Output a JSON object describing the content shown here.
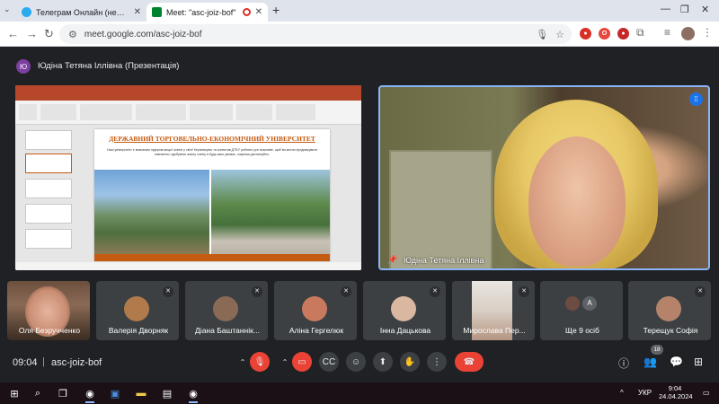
{
  "browser": {
    "tabs": [
      {
        "title": "Телеграм Онлайн (неофіційний)",
        "favicon_color": "#2aabee",
        "active": false
      },
      {
        "title": "Meet: \"asc-joiz-bof\"",
        "favicon_color": "#00832d",
        "active": true,
        "recording": true
      }
    ],
    "new_tab_label": "+",
    "url": "meet.google.com/asc-joiz-bof"
  },
  "meet": {
    "presenter_initial": "Ю",
    "presenter_label": "Юдіна Тетяна Іллівна (Презентація)",
    "slide": {
      "title": "ДЕРЖАВНИЙ ТОРГОВЕЛЬНО-ЕКОНОМІЧНИЙ УНІВЕРСИТЕТ",
      "text": "Наш університет є визнаним лідером вищої освіти у світі! Керівництво та колектив ДТЕУ роблять усе можливе, щоб ви могли продовжувати навчання і здобувати якісну освіту в будь-яких умовах, зокрема дистанційно."
    },
    "speaker_name": "Юдіна Тетяна Іллівна",
    "participants": [
      {
        "name": "Оля Безручченко",
        "avatar_color": "",
        "muted": false,
        "video": true
      },
      {
        "name": "Валерія Дворняк",
        "avatar_color": "#b07a4a",
        "muted": true,
        "video": false
      },
      {
        "name": "Діана Баштаннік...",
        "avatar_color": "#8a6a55",
        "muted": true,
        "video": false
      },
      {
        "name": "Аліна Гергелюк",
        "avatar_color": "#c97a5e",
        "muted": true,
        "video": false
      },
      {
        "name": "Інна Дацькова",
        "avatar_color": "#d9b7a0",
        "muted": true,
        "video": false
      },
      {
        "name": "Мирослава Пер...",
        "avatar_color": "",
        "muted": true,
        "video": true
      },
      {
        "name": "Ще 9 осіб",
        "avatar_color": "#5f6368",
        "muted": false,
        "video": false,
        "more_initial": "А"
      },
      {
        "name": "Терещук Софія",
        "avatar_color": "#b5836a",
        "muted": true,
        "video": false
      }
    ],
    "clock": "09:04",
    "meeting_code": "asc-joiz-bof",
    "participant_count": "18"
  },
  "taskbar": {
    "language": "УКР",
    "time": "9:04",
    "date": "24.04.2024"
  }
}
